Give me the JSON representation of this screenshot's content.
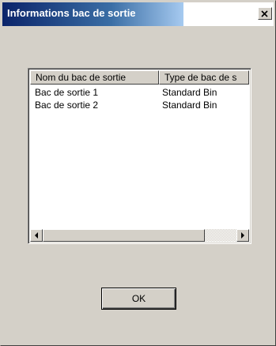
{
  "window": {
    "title": "Informations bac de sortie"
  },
  "list": {
    "columns": [
      "Nom du bac de sortie",
      "Type de bac de s"
    ],
    "rows": [
      [
        "Bac de sortie 1",
        "Standard Bin"
      ],
      [
        "Bac de sortie 2",
        "Standard Bin"
      ]
    ]
  },
  "buttons": {
    "ok_label": "OK"
  },
  "icons": {
    "close": "close-icon",
    "scroll_left": "arrow-left-icon",
    "scroll_right": "arrow-right-icon"
  }
}
